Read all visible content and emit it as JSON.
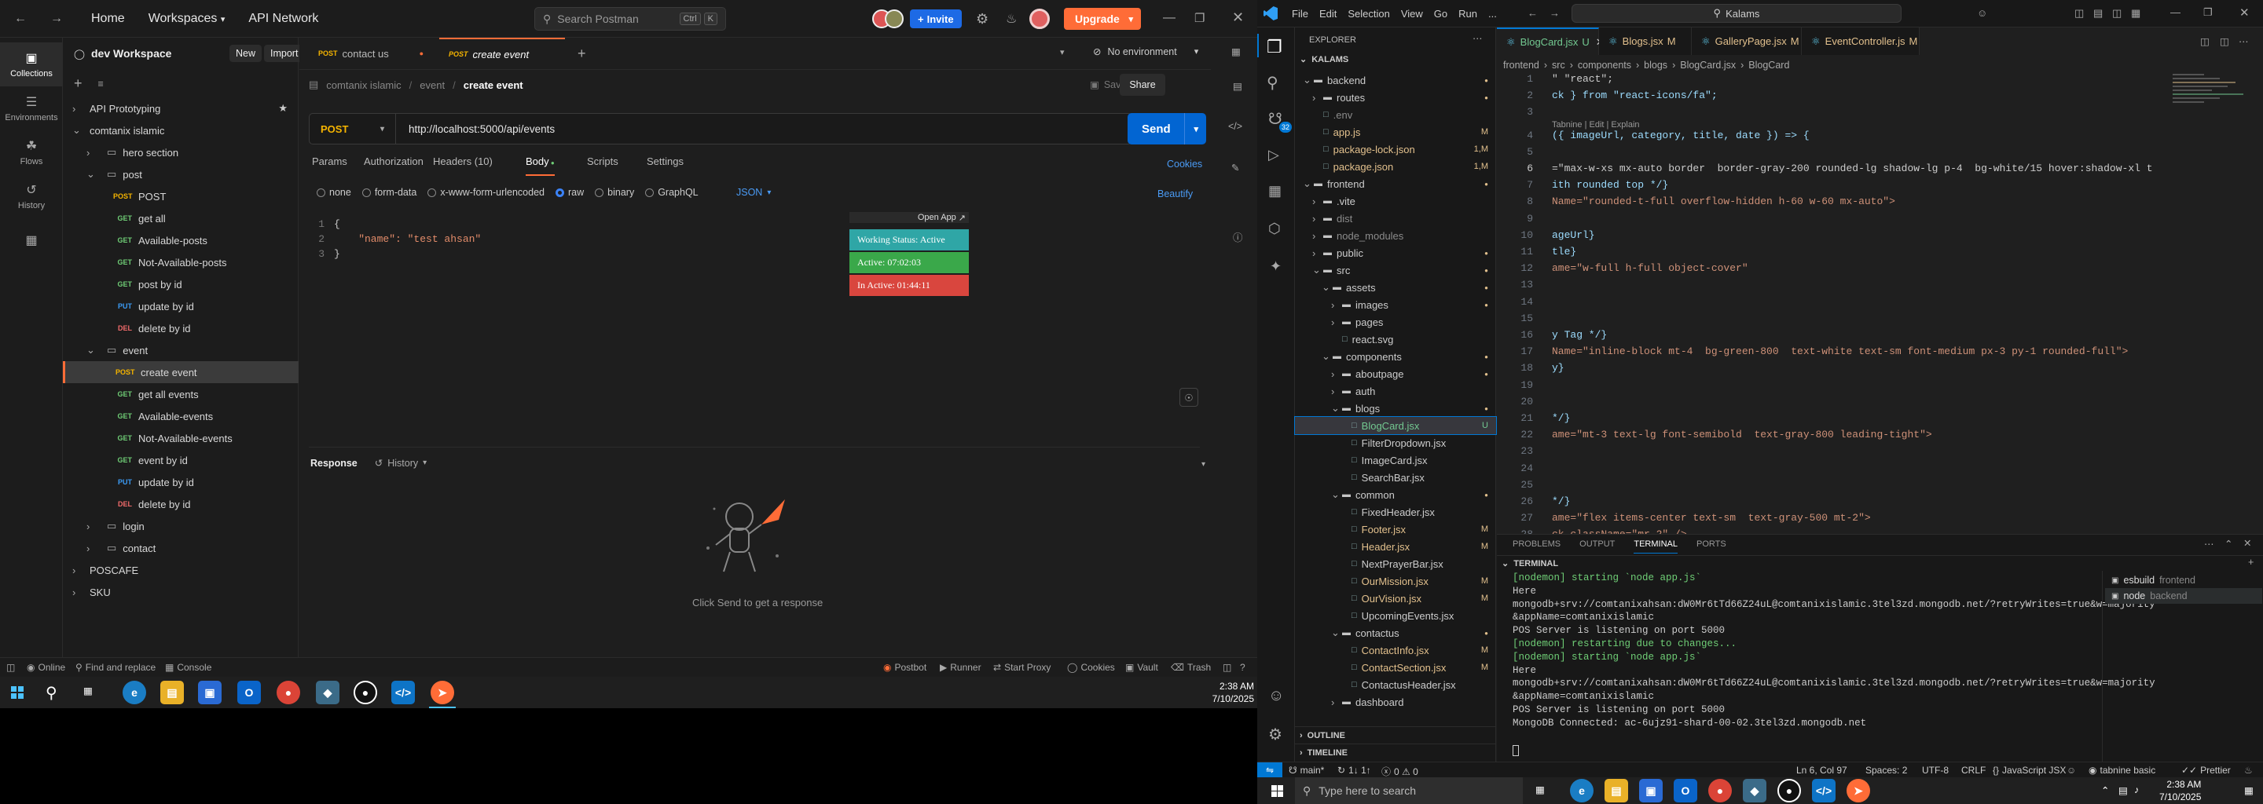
{
  "postman": {
    "nav": {
      "home": "Home",
      "workspaces": "Workspaces",
      "api_network": "API Network"
    },
    "search": {
      "placeholder": "Search Postman",
      "kbd1": "Ctrl",
      "kbd2": "K"
    },
    "invite": "Invite",
    "upgrade": "Upgrade",
    "workspace_name": "dev Workspace",
    "new_btn": "New",
    "import_btn": "Import",
    "sidebar": [
      {
        "label": "Collections",
        "icon": "collections-icon"
      },
      {
        "label": "Environments",
        "icon": "environments-icon"
      },
      {
        "label": "Flows",
        "icon": "flows-icon"
      },
      {
        "label": "History",
        "icon": "history-icon"
      },
      {
        "label": "",
        "icon": "apps-icon"
      }
    ],
    "tree": [
      {
        "type": "collection",
        "label": "API Prototyping",
        "depth": 0,
        "star": true
      },
      {
        "type": "collection-open",
        "label": "comtanix islamic",
        "depth": 0
      },
      {
        "type": "folder",
        "label": "hero section",
        "depth": 1
      },
      {
        "type": "folder-open",
        "label": "post",
        "depth": 1
      },
      {
        "type": "req",
        "method": "POST",
        "label": "POST",
        "depth": 2
      },
      {
        "type": "req",
        "method": "GET",
        "label": "get all",
        "depth": 2
      },
      {
        "type": "req",
        "method": "GET",
        "label": "Available-posts",
        "depth": 2
      },
      {
        "type": "req",
        "method": "GET",
        "label": "Not-Available-posts",
        "depth": 2
      },
      {
        "type": "req",
        "method": "GET",
        "label": "post by id",
        "depth": 2
      },
      {
        "type": "req",
        "method": "PUT",
        "label": "update by id",
        "depth": 2
      },
      {
        "type": "req",
        "method": "DEL",
        "label": "delete by id",
        "depth": 2
      },
      {
        "type": "folder-open",
        "label": "event",
        "depth": 1
      },
      {
        "type": "req",
        "method": "POST",
        "label": "create event",
        "depth": 2,
        "selected": true
      },
      {
        "type": "req",
        "method": "GET",
        "label": "get all events",
        "depth": 2
      },
      {
        "type": "req",
        "method": "GET",
        "label": "Available-events",
        "depth": 2
      },
      {
        "type": "req",
        "method": "GET",
        "label": "Not-Available-events",
        "depth": 2
      },
      {
        "type": "req",
        "method": "GET",
        "label": "event by id",
        "depth": 2
      },
      {
        "type": "req",
        "method": "PUT",
        "label": "update by id",
        "depth": 2
      },
      {
        "type": "req",
        "method": "DEL",
        "label": "delete by id",
        "depth": 2
      },
      {
        "type": "folder",
        "label": "login",
        "depth": 1
      },
      {
        "type": "folder",
        "label": "contact",
        "depth": 1
      },
      {
        "type": "collection",
        "label": "POSCAFE",
        "depth": 0
      },
      {
        "type": "collection",
        "label": "SKU",
        "depth": 0
      }
    ],
    "tabs": [
      {
        "method": "POST",
        "label": "contact us",
        "dirty": true
      },
      {
        "method": "POST",
        "label": "create event",
        "active": true
      }
    ],
    "no_environment": "No environment",
    "breadcrumb": {
      "a": "comtanix islamic",
      "b": "event",
      "c": "create event"
    },
    "save": "Save",
    "share": "Share",
    "method": "POST",
    "url": "http://localhost:5000/api/events",
    "send": "Send",
    "req_tabs": [
      "Params",
      "Authorization",
      "Headers (10)",
      "Body",
      "Scripts",
      "Settings"
    ],
    "cookies": "Cookies",
    "body_types": [
      "none",
      "form-data",
      "x-www-form-urlencoded",
      "raw",
      "binary",
      "GraphQL"
    ],
    "body_lang": "JSON",
    "beautify": "Beautify",
    "json_lines": [
      "{",
      "    \"name\": \"test ahsan\"",
      "}"
    ],
    "overlay": {
      "open": "Open App",
      "working": "Working Status: Active",
      "active": "Active: 07:02:03",
      "inactive": "In Active: 01:44:11"
    },
    "response": "Response",
    "history": "History",
    "response_hint": "Click Send to get a response",
    "status": {
      "online": "Online",
      "find": "Find and replace",
      "console": "Console",
      "postbot": "Postbot",
      "runner": "Runner",
      "proxy": "Start Proxy",
      "cookies": "Cookies",
      "vault": "Vault",
      "trash": "Trash"
    }
  },
  "taskbar1": {
    "time": "2:38 AM",
    "date": "7/10/2025"
  },
  "vscode": {
    "menu": [
      "File",
      "Edit",
      "Selection",
      "View",
      "Go",
      "Run",
      "..."
    ],
    "search": "Kalams",
    "explorer": "EXPLORER",
    "root": "KALAMS",
    "tree": [
      {
        "label": "backend",
        "depth": 0,
        "kind": "folder-open",
        "color": "#cccccc",
        "dot": true
      },
      {
        "label": "routes",
        "depth": 1,
        "kind": "folder",
        "color": "#cccccc",
        "dot": true
      },
      {
        "label": ".env",
        "depth": 1,
        "kind": "file",
        "color": "#8b8b8b"
      },
      {
        "label": "app.js",
        "depth": 1,
        "kind": "file",
        "color": "#e2c08d",
        "badge": "M"
      },
      {
        "label": "package-lock.json",
        "depth": 1,
        "kind": "file",
        "color": "#e2c08d",
        "badge": "1,M"
      },
      {
        "label": "package.json",
        "depth": 1,
        "kind": "file",
        "color": "#e2c08d",
        "badge": "1,M"
      },
      {
        "label": "frontend",
        "depth": 0,
        "kind": "folder-open",
        "color": "#cccccc",
        "dot": true
      },
      {
        "label": ".vite",
        "depth": 1,
        "kind": "folder",
        "color": "#cccccc"
      },
      {
        "label": "dist",
        "depth": 1,
        "kind": "folder",
        "color": "#8b8b8b"
      },
      {
        "label": "node_modules",
        "depth": 1,
        "kind": "folder",
        "color": "#8b8b8b"
      },
      {
        "label": "public",
        "depth": 1,
        "kind": "folder",
        "color": "#cccccc",
        "dot": true
      },
      {
        "label": "src",
        "depth": 1,
        "kind": "folder-open",
        "color": "#cccccc",
        "dot": true
      },
      {
        "label": "assets",
        "depth": 2,
        "kind": "folder-open",
        "color": "#cccccc",
        "dot": true
      },
      {
        "label": "images",
        "depth": 3,
        "kind": "folder",
        "color": "#cccccc",
        "dot": true
      },
      {
        "label": "pages",
        "depth": 3,
        "kind": "folder",
        "color": "#cccccc"
      },
      {
        "label": "react.svg",
        "depth": 3,
        "kind": "file",
        "color": "#cccccc"
      },
      {
        "label": "components",
        "depth": 2,
        "kind": "folder-open",
        "color": "#cccccc",
        "dot": true
      },
      {
        "label": "aboutpage",
        "depth": 3,
        "kind": "folder",
        "color": "#cccccc",
        "dot": true
      },
      {
        "label": "auth",
        "depth": 3,
        "kind": "folder",
        "color": "#cccccc"
      },
      {
        "label": "blogs",
        "depth": 3,
        "kind": "folder-open",
        "color": "#cccccc",
        "dot": true
      },
      {
        "label": "BlogCard.jsx",
        "depth": 4,
        "kind": "file",
        "color": "#73c991",
        "badge": "U",
        "selected": true
      },
      {
        "label": "FilterDropdown.jsx",
        "depth": 4,
        "kind": "file",
        "color": "#cccccc"
      },
      {
        "label": "ImageCard.jsx",
        "depth": 4,
        "kind": "file",
        "color": "#cccccc"
      },
      {
        "label": "SearchBar.jsx",
        "depth": 4,
        "kind": "file",
        "color": "#cccccc"
      },
      {
        "label": "common",
        "depth": 3,
        "kind": "folder-open",
        "color": "#cccccc",
        "dot": true
      },
      {
        "label": "FixedHeader.jsx",
        "depth": 4,
        "kind": "file",
        "color": "#cccccc"
      },
      {
        "label": "Footer.jsx",
        "depth": 4,
        "kind": "file",
        "color": "#e2c08d",
        "badge": "M"
      },
      {
        "label": "Header.jsx",
        "depth": 4,
        "kind": "file",
        "color": "#e2c08d",
        "badge": "M"
      },
      {
        "label": "NextPrayerBar.jsx",
        "depth": 4,
        "kind": "file",
        "color": "#cccccc"
      },
      {
        "label": "OurMission.jsx",
        "depth": 4,
        "kind": "file",
        "color": "#e2c08d",
        "badge": "M"
      },
      {
        "label": "OurVision.jsx",
        "depth": 4,
        "kind": "file",
        "color": "#e2c08d",
        "badge": "M"
      },
      {
        "label": "UpcomingEvents.jsx",
        "depth": 4,
        "kind": "file",
        "color": "#cccccc"
      },
      {
        "label": "contactus",
        "depth": 3,
        "kind": "folder-open",
        "color": "#cccccc",
        "dot": true
      },
      {
        "label": "ContactInfo.jsx",
        "depth": 4,
        "kind": "file",
        "color": "#e2c08d",
        "badge": "M"
      },
      {
        "label": "ContactSection.jsx",
        "depth": 4,
        "kind": "file",
        "color": "#e2c08d",
        "badge": "M"
      },
      {
        "label": "ContactusHeader.jsx",
        "depth": 4,
        "kind": "file",
        "color": "#cccccc"
      },
      {
        "label": "dashboard",
        "depth": 3,
        "kind": "folder",
        "color": "#cccccc"
      }
    ],
    "outline": "OUTLINE",
    "timeline": "TIMELINE",
    "tabs": [
      {
        "label": "BlogCard.jsx",
        "badge": "U",
        "active": true,
        "color": "#73c991"
      },
      {
        "label": "Blogs.jsx",
        "badge": "M",
        "color": "#e2c08d"
      },
      {
        "label": "GalleryPage.jsx",
        "badge": "M",
        "color": "#e2c08d"
      },
      {
        "label": "EventController.js",
        "badge": "M",
        "color": "#e2c08d"
      }
    ],
    "path": [
      "frontend",
      "src",
      "components",
      "blogs",
      "BlogCard.jsx",
      "BlogCard"
    ],
    "tabnine_hint": "Tabnine | Edit | Explain",
    "code": [
      {
        "n": "1",
        "t": "\" \"react\";"
      },
      {
        "n": "2",
        "t": "ck } from \"react-icons/fa\";"
      },
      {
        "n": "3",
        "t": ""
      },
      {
        "n": "4",
        "t": "({ imageUrl, category, title, date }) => {"
      },
      {
        "n": "5",
        "t": ""
      },
      {
        "n": "6",
        "t": "=\"max-w-xs mx-auto border  border-gray-200 rounded-lg shadow-lg p-4  bg-white/15 hover:shadow-xl t"
      },
      {
        "n": "7",
        "t": "ith rounded top */}"
      },
      {
        "n": "8",
        "t": "Name=\"rounded-t-full overflow-hidden h-60 w-60 mx-auto\">"
      },
      {
        "n": "9",
        "t": ""
      },
      {
        "n": "10",
        "t": "ageUrl}"
      },
      {
        "n": "11",
        "t": "tle}"
      },
      {
        "n": "12",
        "t": "ame=\"w-full h-full object-cover\""
      },
      {
        "n": "13",
        "t": ""
      },
      {
        "n": "14",
        "t": ""
      },
      {
        "n": "15",
        "t": ""
      },
      {
        "n": "16",
        "t": "y Tag */}"
      },
      {
        "n": "17",
        "t": "Name=\"inline-block mt-4  bg-green-800  text-white text-sm font-medium px-3 py-1 rounded-full\">"
      },
      {
        "n": "18",
        "t": "y}"
      },
      {
        "n": "19",
        "t": ""
      },
      {
        "n": "20",
        "t": ""
      },
      {
        "n": "21",
        "t": "*/}"
      },
      {
        "n": "22",
        "t": "ame=\"mt-3 text-lg font-semibold  text-gray-800 leading-tight\">"
      },
      {
        "n": "23",
        "t": ""
      },
      {
        "n": "24",
        "t": ""
      },
      {
        "n": "25",
        "t": ""
      },
      {
        "n": "26",
        "t": "*/}"
      },
      {
        "n": "27",
        "t": "ame=\"flex items-center text-sm  text-gray-500 mt-2\">"
      },
      {
        "n": "28",
        "t": "ck className=\"mr-2\" />"
      },
      {
        "n": "29",
        "t": "te}</span>"
      },
      {
        "n": "30",
        "t": ""
      }
    ],
    "panel_tabs": [
      "PROBLEMS",
      "OUTPUT",
      "TERMINAL",
      "PORTS"
    ],
    "terminal_title": "TERMINAL",
    "terminal": [
      {
        "t": "[nodemon] starting `node app.js`",
        "c": "#6fce76"
      },
      {
        "t": "Here",
        "c": "#cccccc"
      },
      {
        "t": "mongodb+srv://comtanixahsan:dW0Mr6tTd66Z24uL@comtanixislamic.3tel3zd.mongodb.net/?retryWrites=true&w=majority",
        "c": "#cccccc"
      },
      {
        "t": "&appName=comtanixislamic",
        "c": "#cccccc"
      },
      {
        "t": "POS Server is listening on port 5000",
        "c": "#cccccc"
      },
      {
        "t": "[nodemon] restarting due to changes...",
        "c": "#6fce76"
      },
      {
        "t": "[nodemon] starting `node app.js`",
        "c": "#6fce76"
      },
      {
        "t": "Here",
        "c": "#cccccc"
      },
      {
        "t": "mongodb+srv://comtanixahsan:dW0Mr6tTd66Z24uL@comtanixislamic.3tel3zd.mongodb.net/?retryWrites=true&w=majority",
        "c": "#cccccc"
      },
      {
        "t": "&appName=comtanixislamic",
        "c": "#cccccc"
      },
      {
        "t": "POS Server is listening on port 5000",
        "c": "#cccccc"
      },
      {
        "t": "MongoDB Connected: ac-6ujz91-shard-00-02.3tel3zd.mongodb.net",
        "c": "#cccccc"
      }
    ],
    "terminals": [
      {
        "label": "esbuild",
        "sub": "frontend"
      },
      {
        "label": "node",
        "sub": "backend"
      }
    ],
    "status": {
      "branch": "main*",
      "sync": "1↓ 1↑",
      "problems": "0 ⚠ 0",
      "pos": "Ln 6, Col 97",
      "spaces": "Spaces: 2",
      "enc": "UTF-8",
      "eol": "CRLF",
      "lang": "JavaScript JSX",
      "tabnine": "tabnine basic",
      "prettier": "Prettier"
    }
  },
  "taskbar2": {
    "search": "Type here to search",
    "time": "2:38 AM",
    "date": "7/10/2025"
  },
  "colors": {
    "postman_orange": "#ff6c37",
    "vscode_blue": "#0078d4",
    "send_blue": "#0265d2"
  }
}
